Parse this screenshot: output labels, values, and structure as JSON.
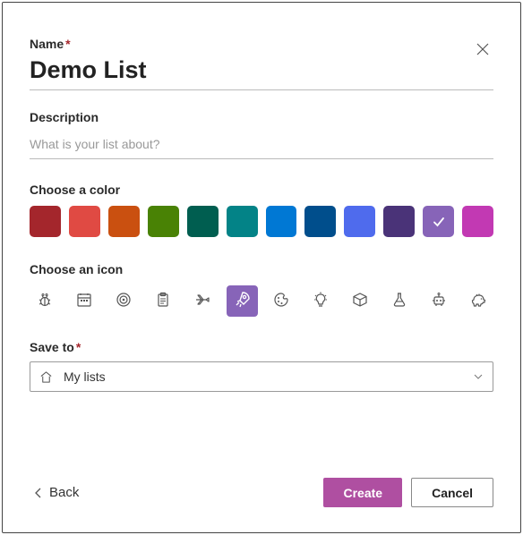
{
  "name_field": {
    "label": "Name",
    "required": "*",
    "value": "Demo List"
  },
  "desc_field": {
    "label": "Description",
    "placeholder": "What is your list about?",
    "value": ""
  },
  "color_section": {
    "label": "Choose a color",
    "selected_index": 10,
    "swatches": [
      "#A4262C",
      "#E04A43",
      "#CA5010",
      "#498205",
      "#005E50",
      "#038387",
      "#0078D4",
      "#004E8C",
      "#4F6BED",
      "#4A3378",
      "#8764B8",
      "#C239B3"
    ],
    "checkmark": "✓"
  },
  "icon_section": {
    "label": "Choose an icon",
    "selected_index": 5,
    "icons": [
      "bug-icon",
      "calendar-icon",
      "target-icon",
      "clipboard-icon",
      "airplane-icon",
      "rocket-icon",
      "palette-icon",
      "lightbulb-icon",
      "cube-icon",
      "flask-icon",
      "robot-icon",
      "piggybank-icon"
    ]
  },
  "saveto": {
    "label": "Save to",
    "required": "*",
    "value": "My lists"
  },
  "footer": {
    "back": "Back",
    "create": "Create",
    "cancel": "Cancel"
  },
  "primary_color": "#AF4FA1"
}
